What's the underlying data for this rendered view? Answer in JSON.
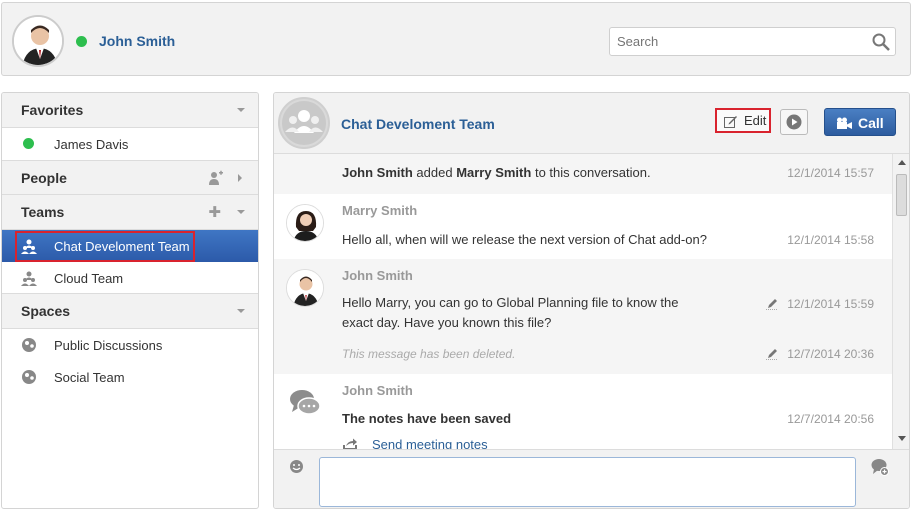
{
  "user": {
    "name": "John Smith",
    "status_color": "#2dbe4e"
  },
  "search": {
    "placeholder": "Search"
  },
  "sidebar": {
    "favorites": {
      "title": "Favorites",
      "items": [
        {
          "label": "James Davis",
          "status_color": "#2dbe4e"
        }
      ]
    },
    "people": {
      "title": "People"
    },
    "teams": {
      "title": "Teams",
      "items": [
        {
          "label": "Chat Develoment Team",
          "selected": true
        },
        {
          "label": "Cloud Team",
          "selected": false
        }
      ]
    },
    "spaces": {
      "title": "Spaces",
      "items": [
        {
          "label": "Public Discussions"
        },
        {
          "label": "Social Team"
        }
      ]
    }
  },
  "chat": {
    "title": "Chat Develoment Team",
    "edit_label": "Edit",
    "call_label": "Call",
    "messages": {
      "system": {
        "actor": "John Smith",
        "action": "added",
        "target": "Marry Smith",
        "suffix": "to this conversation.",
        "time": "12/1/2014 15:57"
      },
      "m1": {
        "author": "Marry Smith",
        "text": "Hello all, when will we release the next version of Chat add-on?",
        "time": "12/1/2014 15:58"
      },
      "m2": {
        "author": "John Smith",
        "text_line1": "Hello Marry, you can go to Global Planning file to know the",
        "text_line2": "exact day. Have you known this file?",
        "time": "12/1/2014 15:59",
        "deleted_text": "This message has been deleted.",
        "deleted_time": "12/7/2014 20:36"
      },
      "m3": {
        "author": "John Smith",
        "text": "The notes have been saved",
        "time": "12/7/2014 20:56",
        "link": "Send meeting notes"
      }
    }
  },
  "colors": {
    "accent": "#2b5f96",
    "selected": "#3a6bbd",
    "highlight": "#d9232e"
  }
}
